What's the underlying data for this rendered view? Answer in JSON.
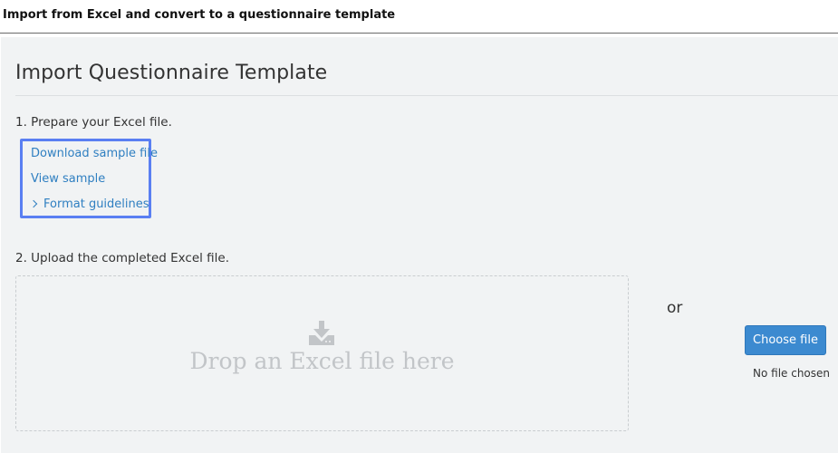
{
  "window": {
    "title": "Import from Excel and convert to a questionnaire template"
  },
  "page": {
    "title": "Import Questionnaire Template"
  },
  "step1": {
    "label": "1. Prepare your Excel file.",
    "links": {
      "download_sample": "Download sample file",
      "view_sample": "View sample",
      "format_guidelines": "Format guidelines"
    }
  },
  "step2": {
    "label": "2. Upload the completed Excel file.",
    "dropzone_text": "Drop an Excel file here",
    "or_text": "or",
    "choose_file_label": "Choose file",
    "file_status": "No file chosen"
  },
  "colors": {
    "accent": "#3c8ad0",
    "link": "#2f7fc1",
    "highlight_box": "#5a7ff2",
    "panel_bg": "#f1f3f4"
  },
  "icons": {
    "format_guidelines": "chevron-right-icon",
    "dropzone": "download-tray-icon"
  }
}
